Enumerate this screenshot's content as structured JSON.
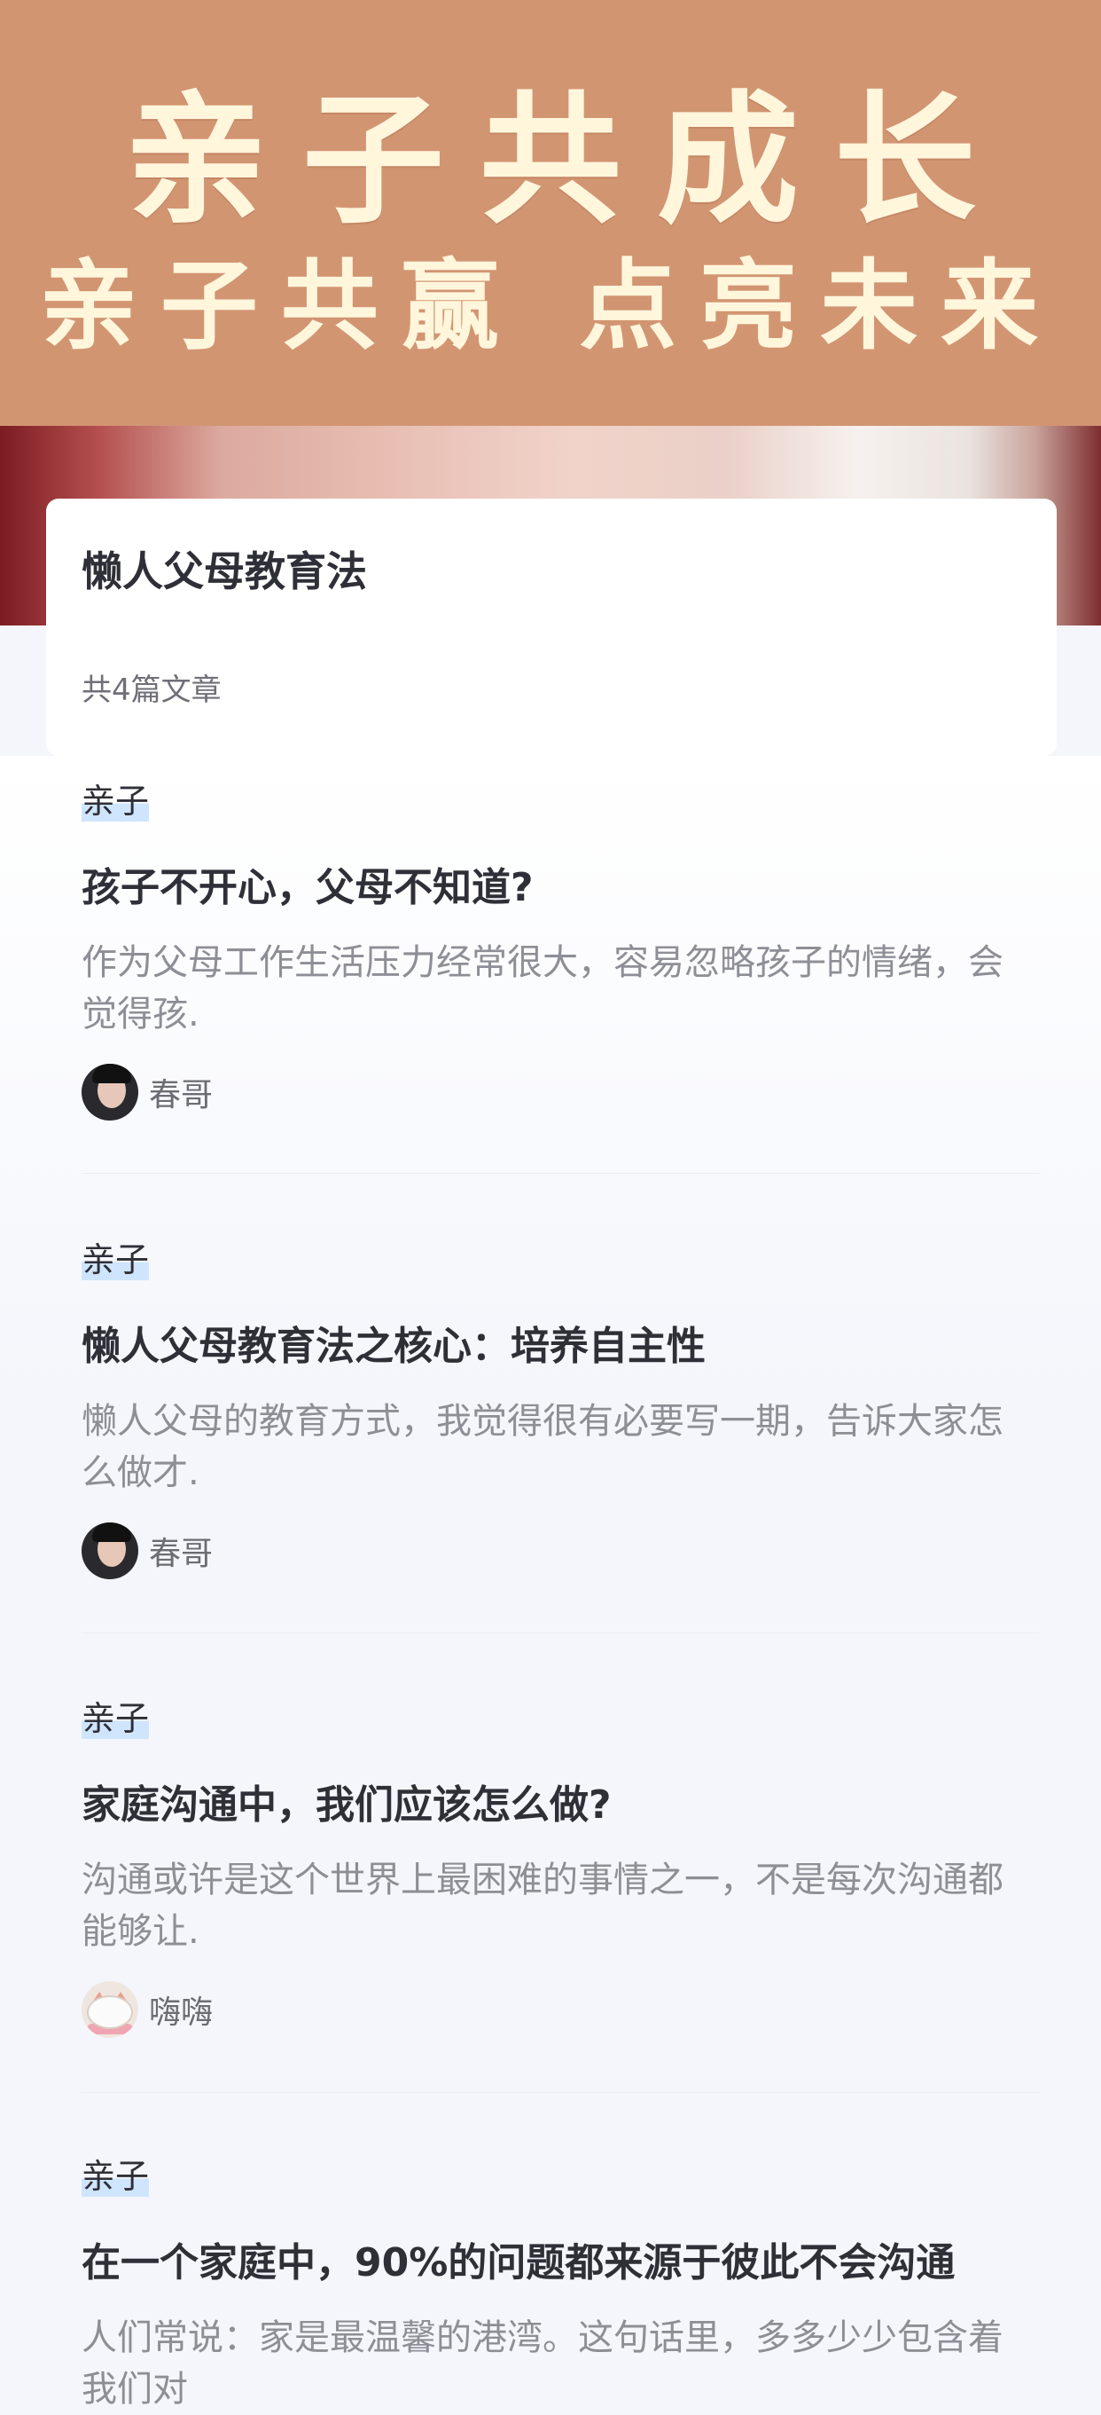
{
  "banner": {
    "title": "亲子共成长",
    "subtitle": "亲子共赢 点亮未来"
  },
  "collection": {
    "title": "懒人父母教育法",
    "count": "共4篇文章"
  },
  "articles": [
    {
      "tag": "亲子",
      "title": "孩子不开心，父母不知道?",
      "summary": "作为父母工作生活压力经常很大，容易忽略孩子的情绪，会觉得孩.",
      "author": "春哥",
      "avatar_icon": "person-avatar"
    },
    {
      "tag": "亲子",
      "title": "懒人父母教育法之核心：培养自主性",
      "summary": "懒人父母的教育方式，我觉得很有必要写一期，告诉大家怎么做才.",
      "author": "春哥",
      "avatar_icon": "person-avatar"
    },
    {
      "tag": "亲子",
      "title": "家庭沟通中，我们应该怎么做?",
      "summary": "沟通或许是这个世界上最困难的事情之一，不是每次沟通都能够让.",
      "author": "嗨嗨",
      "avatar_icon": "cat-avatar"
    },
    {
      "tag": "亲子",
      "title": "在一个家庭中，90%的问题都来源于彼此不会沟通",
      "summary": "人们常说：家是最温馨的港湾。这句话里，多多少少包含着我们对"
    }
  ],
  "colors": {
    "banner_bg": "#d29572",
    "banner_text": "#fff6dc",
    "tag_highlight": "#cfe5fd"
  }
}
